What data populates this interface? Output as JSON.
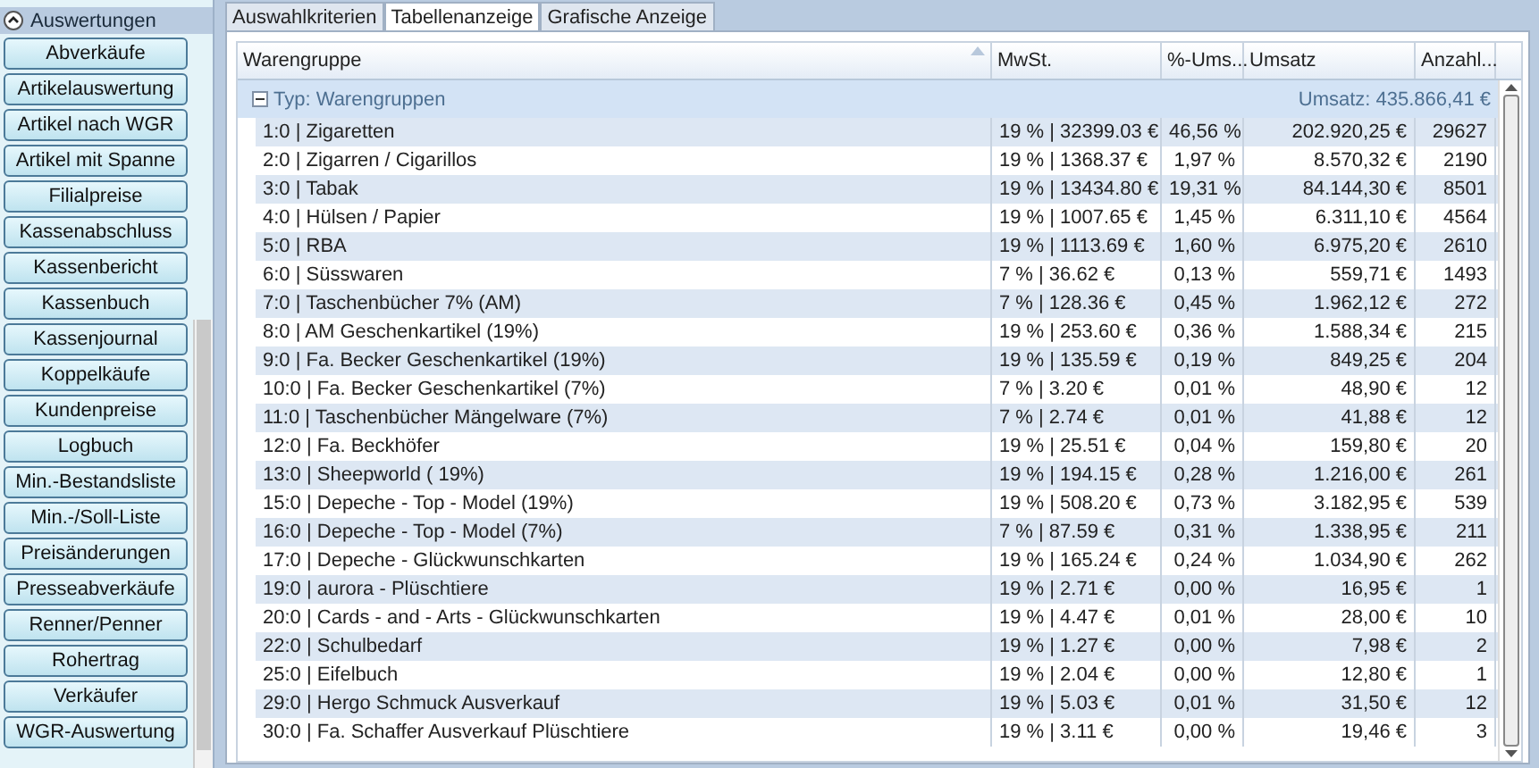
{
  "sidebar": {
    "section": {
      "label": "Auswertungen",
      "expanded": true
    },
    "buttons": [
      "Abverkäufe",
      "Artikelauswertung",
      "Artikel nach WGR",
      "Artikel mit Spanne",
      "Filialpreise",
      "Kassenabschluss",
      "Kassenbericht",
      "Kassenbuch",
      "Kassenjournal",
      "Koppelkäufe",
      "Kundenpreise",
      "Logbuch",
      "Min.-Bestandsliste",
      "Min.-/Soll-Liste",
      "Preisänderungen",
      "Presseabverkäufe",
      "Renner/Penner",
      "Rohertrag",
      "Verkäufer",
      "WGR-Auswertung"
    ]
  },
  "tabs": [
    {
      "label": "Auswahlkriterien",
      "selected": false
    },
    {
      "label": "Tabellenanzeige",
      "selected": true
    },
    {
      "label": "Grafische Anzeige",
      "selected": false
    }
  ],
  "table": {
    "columns": [
      {
        "label": "Warengruppe",
        "sorted": true
      },
      {
        "label": "MwSt.",
        "sorted": false
      },
      {
        "label": "%-Ums...",
        "sorted": false
      },
      {
        "label": "Umsatz",
        "sorted": false
      },
      {
        "label": "Anzahl...",
        "sorted": false
      }
    ],
    "group": {
      "label": "Typ: Warengruppen",
      "expanded": true,
      "summary": "Umsatz: 435.866,41 €"
    },
    "rows": [
      [
        "1:0 | Zigaretten",
        "19 % | 32399.03 €",
        "46,56 %",
        "202.920,25 €",
        "29627"
      ],
      [
        "2:0 | Zigarren / Cigarillos",
        "19 % | 1368.37 €",
        "1,97 %",
        "8.570,32 €",
        "2190"
      ],
      [
        "3:0 | Tabak",
        "19 % | 13434.80 €",
        "19,31 %",
        "84.144,30 €",
        "8501"
      ],
      [
        "4:0 | Hülsen / Papier",
        "19 % | 1007.65 €",
        "1,45 %",
        "6.311,10 €",
        "4564"
      ],
      [
        "5:0 | RBA",
        "19 % | 1113.69 €",
        "1,60 %",
        "6.975,20 €",
        "2610"
      ],
      [
        "6:0 | Süsswaren",
        "7 % | 36.62 €",
        "0,13 %",
        "559,71 €",
        "1493"
      ],
      [
        "7:0 | Taschenbücher 7% (AM)",
        "7 % | 128.36 €",
        "0,45 %",
        "1.962,12 €",
        "272"
      ],
      [
        "8:0 | AM Geschenkartikel (19%)",
        "19 % | 253.60 €",
        "0,36 %",
        "1.588,34 €",
        "215"
      ],
      [
        "9:0 | Fa. Becker Geschenkartikel (19%)",
        "19 % | 135.59 €",
        "0,19 %",
        "849,25 €",
        "204"
      ],
      [
        "10:0 | Fa. Becker Geschenkartikel (7%)",
        "7 % | 3.20 €",
        "0,01 %",
        "48,90 €",
        "12"
      ],
      [
        "11:0 | Taschenbücher Mängelware (7%)",
        "7 % | 2.74 €",
        "0,01 %",
        "41,88 €",
        "12"
      ],
      [
        "12:0 | Fa. Beckhöfer",
        "19 % | 25.51 €",
        "0,04 %",
        "159,80 €",
        "20"
      ],
      [
        "13:0 | Sheepworld ( 19%)",
        "19 % | 194.15 €",
        "0,28 %",
        "1.216,00 €",
        "261"
      ],
      [
        "15:0 | Depeche - Top - Model (19%)",
        "19 % | 508.20 €",
        "0,73 %",
        "3.182,95 €",
        "539"
      ],
      [
        "16:0 | Depeche - Top - Model (7%)",
        "7 % | 87.59 €",
        "0,31 %",
        "1.338,95 €",
        "211"
      ],
      [
        "17:0 | Depeche - Glückwunschkarten",
        "19 % | 165.24 €",
        "0,24 %",
        "1.034,90 €",
        "262"
      ],
      [
        "19:0 | aurora - Plüschtiere",
        "19 % | 2.71 €",
        "0,00 %",
        "16,95 €",
        "1"
      ],
      [
        "20:0 | Cards - and - Arts - Glückwunschkarten",
        "19 % | 4.47 €",
        "0,01 %",
        "28,00 €",
        "10"
      ],
      [
        "22:0 | Schulbedarf",
        "19 % | 1.27 €",
        "0,00 %",
        "7,98 €",
        "2"
      ],
      [
        "25:0 | Eifelbuch",
        "19 % | 2.04 €",
        "0,00 %",
        "12,80 €",
        "1"
      ],
      [
        "29:0 | Hergo Schmuck Ausverkauf",
        "19 % | 5.03 €",
        "0,01 %",
        "31,50 €",
        "12"
      ],
      [
        "30:0 | Fa. Schaffer Ausverkauf Plüschtiere",
        "19 % | 3.11 €",
        "0,00 %",
        "19,46 €",
        "3"
      ]
    ]
  }
}
